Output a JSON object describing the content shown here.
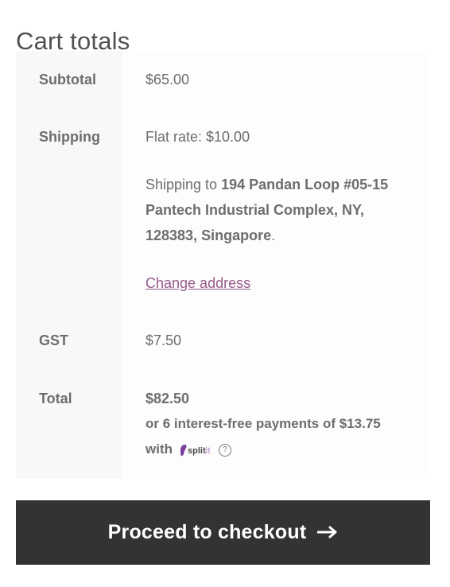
{
  "title": "Cart totals",
  "rows": {
    "subtotal": {
      "label": "Subtotal",
      "value": "$65.00"
    },
    "shipping": {
      "label": "Shipping",
      "rate": "Flat rate: $10.00",
      "to_prefix": "Shipping to",
      "address": "194 Pandan Loop #05-15 Pantech Industrial Complex, NY, 128383, Singapore",
      "suffix": ".",
      "change_address": "Change address"
    },
    "gst": {
      "label": "GST",
      "value": "$7.50"
    },
    "total": {
      "label": "Total",
      "value": "$82.50",
      "installments": "or 6 interest-free payments of $13.75",
      "with": "with",
      "brand_text": "split",
      "brand_suffix": "it"
    }
  },
  "checkout": {
    "label": "Proceed to checkout"
  },
  "colors": {
    "link": "#96588a",
    "button_bg": "#333333",
    "brand_purple": "#7b3fa0"
  },
  "icons": [
    "splitit-logo-icon",
    "help-circle-icon",
    "arrow-right-icon"
  ]
}
